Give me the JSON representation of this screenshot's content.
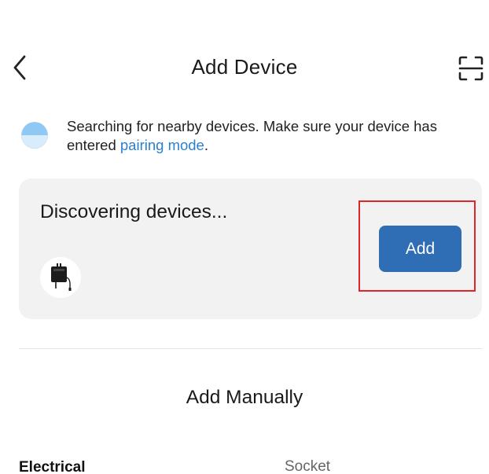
{
  "header": {
    "title": "Add Device",
    "back_icon": "chevron-left-icon",
    "scan_icon": "scan-icon"
  },
  "search_notice": {
    "text_before_link": "Searching for nearby devices. Make sure your device has entered ",
    "link_text": "pairing mode",
    "text_after_link": ".",
    "link_color": "#2a7fd0"
  },
  "discovery_card": {
    "title": "Discovering devices...",
    "add_button_label": "Add",
    "add_button_color": "#2f6db5",
    "device_icon": "power-adapter-icon"
  },
  "manual": {
    "title": "Add Manually",
    "categories": [
      {
        "label": "Electrical",
        "selected": true
      },
      {
        "label": "Socket",
        "selected": false
      }
    ]
  },
  "colors": {
    "highlight_border": "#e0242b",
    "card_background": "#f2f2f2"
  }
}
